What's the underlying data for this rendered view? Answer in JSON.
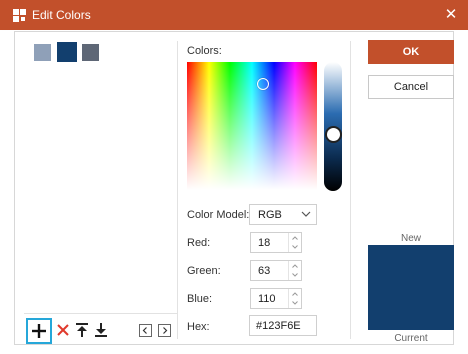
{
  "window": {
    "title": "Edit Colors",
    "app_icon": "color-palette-icon",
    "close_icon": "close-icon"
  },
  "swatches": [
    {
      "color": "#8fa0b8"
    },
    {
      "color": "#123f6e",
      "selected": true
    },
    {
      "color": "#5e6776"
    }
  ],
  "picker": {
    "label": "Colors:"
  },
  "color_model": {
    "label": "Color Model:",
    "value": "RGB"
  },
  "rgb": {
    "red": {
      "label": "Red:",
      "value": "18"
    },
    "green": {
      "label": "Green:",
      "value": "63"
    },
    "blue": {
      "label": "Blue:",
      "value": "110"
    }
  },
  "hex": {
    "label": "Hex:",
    "value": "#123F6E"
  },
  "buttons": {
    "ok": "OK",
    "cancel": "Cancel"
  },
  "preview": {
    "new_label": "New",
    "current_label": "Current",
    "new_color": "#123f6e"
  },
  "toolbar": [
    "add-icon",
    "delete-icon",
    "move-to-top-icon",
    "move-to-bottom-icon",
    "previous-icon",
    "next-icon"
  ],
  "colors": {
    "accent": "#c2502b",
    "focus": "#26a7d9",
    "delete": "#e0392c"
  }
}
